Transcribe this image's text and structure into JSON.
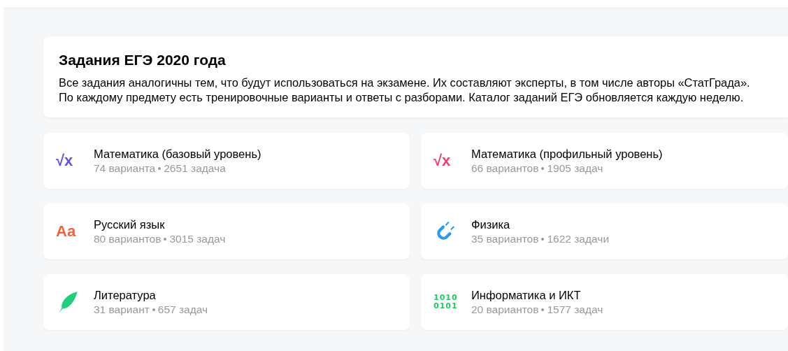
{
  "header": {
    "title": "Задания ЕГЭ 2020 года",
    "description": "Все задания аналогичны тем, что будут использоваться на экзамене. Их составляют эксперты, в том числе авторы «СтатГрада». По каждому предмету есть тренировочные варианты и ответы с разборами. Каталог заданий ЕГЭ обновляется каждую неделю."
  },
  "subjects": [
    {
      "name": "Математика (базовый уровень)",
      "variants": "74 варианта",
      "tasks": "2651 задача",
      "icon": {
        "kind": "glyph",
        "lines": [
          "√x"
        ],
        "color": "#6a4fe0"
      }
    },
    {
      "name": "Математика (профильный уровень)",
      "variants": "66 вариантов",
      "tasks": "1905 задач",
      "icon": {
        "kind": "glyph",
        "lines": [
          "√x"
        ],
        "color": "#f0406a"
      }
    },
    {
      "name": "Русский язык",
      "variants": "80 вариантов",
      "tasks": "3015 задач",
      "icon": {
        "kind": "glyph",
        "lines": [
          "Aa"
        ],
        "color": "#f8603a"
      }
    },
    {
      "name": "Физика",
      "variants": "35 вариантов",
      "tasks": "1622 задачи",
      "icon": {
        "kind": "magnet",
        "color": "#2a9cf0"
      }
    },
    {
      "name": "Литература",
      "variants": "31 вариант",
      "tasks": "657 задач",
      "icon": {
        "kind": "feather",
        "color": "#1fcf7e"
      }
    },
    {
      "name": "Информатика и ИКТ",
      "variants": "20 вариантов",
      "tasks": "1577 задач",
      "icon": {
        "kind": "glyph",
        "lines": [
          "1010",
          "0101"
        ],
        "color": "#1fcf5e"
      }
    }
  ]
}
